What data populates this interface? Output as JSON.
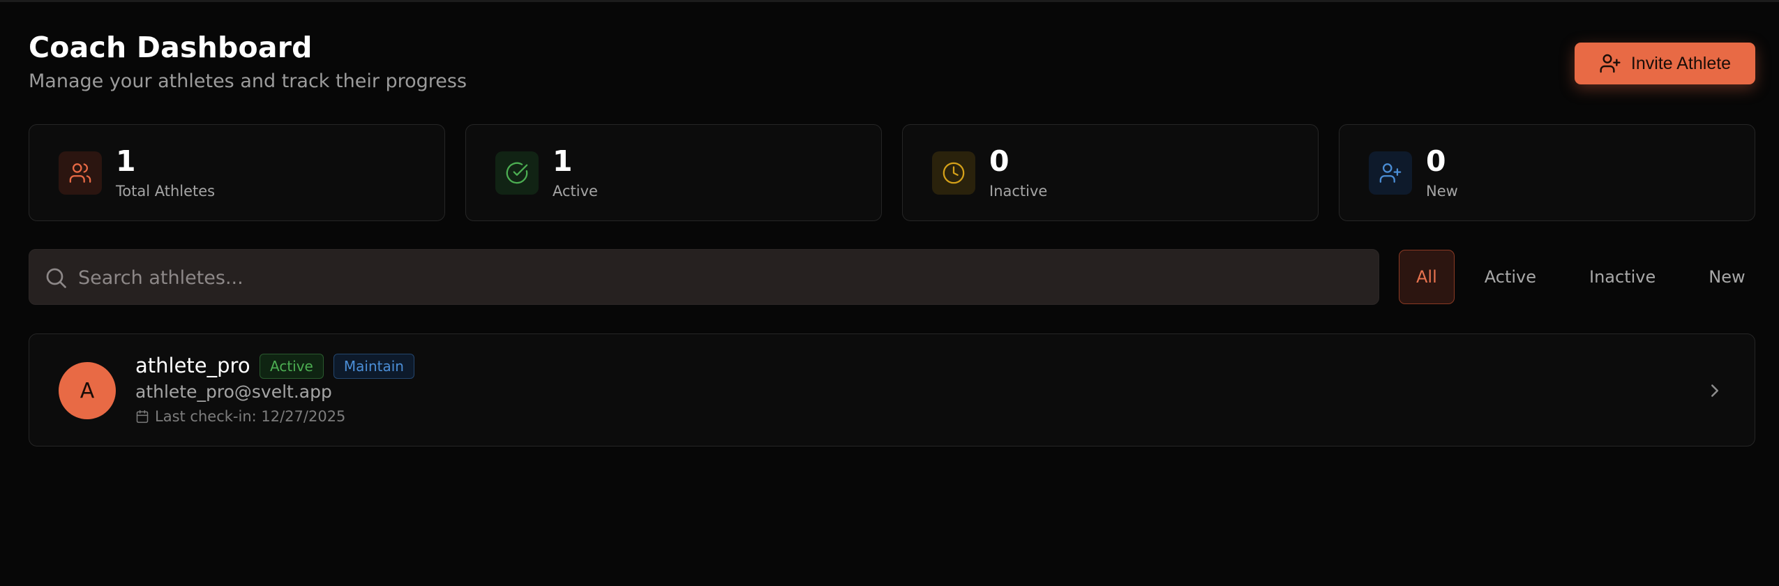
{
  "header": {
    "title": "Coach Dashboard",
    "subtitle": "Manage your athletes and track their progress",
    "invite_label": "Invite Athlete"
  },
  "stats": [
    {
      "value": "1",
      "label": "Total Athletes",
      "icon": "users-icon",
      "color": "#e86a45"
    },
    {
      "value": "1",
      "label": "Active",
      "icon": "check-circle-icon",
      "color": "#4cae52"
    },
    {
      "value": "0",
      "label": "Inactive",
      "icon": "clock-icon",
      "color": "#d4a019"
    },
    {
      "value": "0",
      "label": "New",
      "icon": "user-plus-icon",
      "color": "#4b8ed6"
    }
  ],
  "search": {
    "placeholder": "Search athletes..."
  },
  "filters": [
    "All",
    "Active",
    "Inactive",
    "New"
  ],
  "selected_filter": "All",
  "athletes": [
    {
      "initial": "A",
      "name": "athlete_pro",
      "status": "Active",
      "goal": "Maintain",
      "email": "athlete_pro@svelt.app",
      "last_checkin": "Last check-in: 12/27/2025"
    }
  ],
  "colors": {
    "accent": "#e86a45",
    "background": "#070707",
    "card": "#0c0c0c"
  }
}
